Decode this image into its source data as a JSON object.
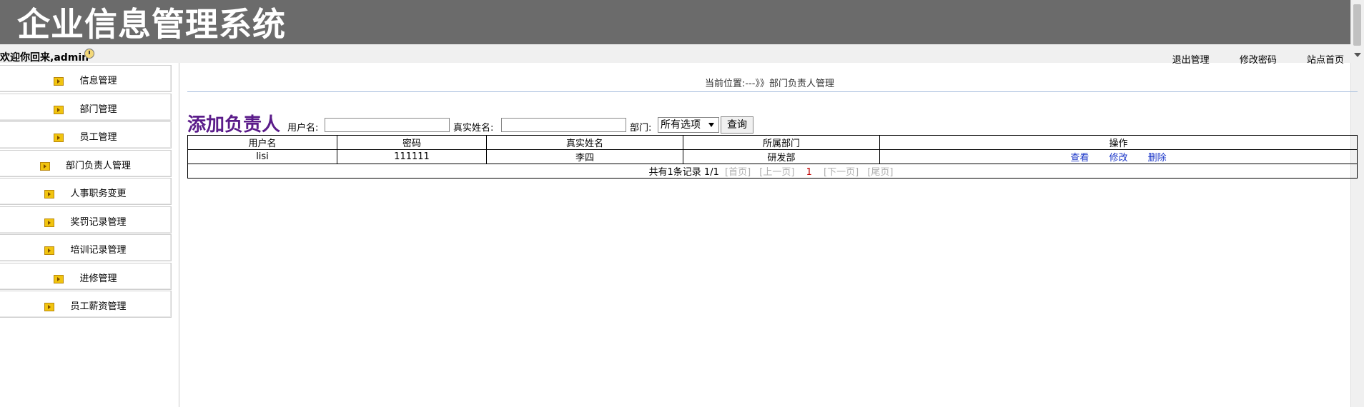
{
  "header": {
    "title": "企业信息管理系统"
  },
  "topbar": {
    "welcome": "欢迎你回来,admin",
    "links": [
      "退出管理",
      "修改密码",
      "站点首页"
    ]
  },
  "sidebar": {
    "items": [
      "信息管理",
      "部门管理",
      "员工管理",
      "部门负责人管理",
      "人事职务变更",
      "奖罚记录管理",
      "培训记录管理",
      "进修管理",
      "员工薪资管理"
    ]
  },
  "breadcrumb": "当前位置:---》》部门负责人管理",
  "form": {
    "title": "添加负责人",
    "username_label": "用户名:",
    "username_value": "",
    "realname_label": "真实姓名:",
    "realname_value": "",
    "dept_label": "部门:",
    "dept_selected": "所有选项",
    "query_button": "查询"
  },
  "table": {
    "headers": [
      "用户名",
      "密码",
      "真实姓名",
      "所属部门",
      "操作"
    ],
    "rows": [
      {
        "username": "lisi",
        "password": "111111",
        "realname": "李四",
        "dept": "研发部",
        "actions": [
          "查看",
          "修改",
          "删除"
        ]
      }
    ],
    "pager": {
      "summary": "共有1条记录  1/1",
      "first": "[首页]",
      "prev": "[上一页]",
      "current": "1",
      "next": "[下一页]",
      "last": "[尾页]"
    }
  }
}
